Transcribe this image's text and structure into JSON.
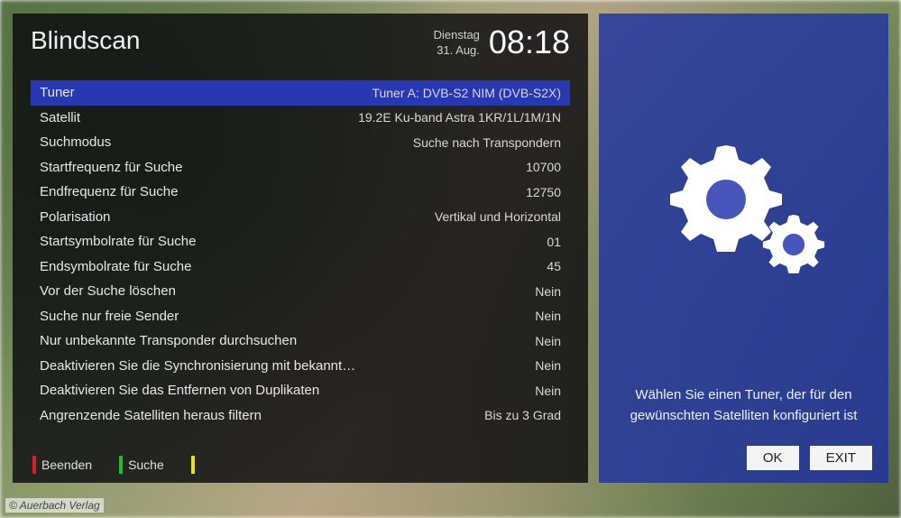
{
  "header": {
    "title": "Blindscan",
    "weekday": "Dienstag",
    "date": "31. Aug.",
    "time": "08:18"
  },
  "options": [
    {
      "label": "Tuner",
      "value": "Tuner A: DVB-S2 NIM (DVB-S2X)",
      "selected": true
    },
    {
      "label": "Satellit",
      "value": "19.2E Ku-band Astra 1KR/1L/1M/1N",
      "selected": false
    },
    {
      "label": "Suchmodus",
      "value": "Suche nach Transpondern",
      "selected": false
    },
    {
      "label": "Startfrequenz für Suche",
      "value": "10700",
      "selected": false
    },
    {
      "label": "Endfrequenz für Suche",
      "value": "12750",
      "selected": false
    },
    {
      "label": "Polarisation",
      "value": "Vertikal und Horizontal",
      "selected": false
    },
    {
      "label": "Startsymbolrate für Suche",
      "value": "01",
      "selected": false
    },
    {
      "label": "Endsymbolrate für Suche",
      "value": "45",
      "selected": false
    },
    {
      "label": "Vor der Suche löschen",
      "value": "Nein",
      "selected": false
    },
    {
      "label": "Suche nur freie Sender",
      "value": "Nein",
      "selected": false
    },
    {
      "label": "Nur unbekannte Transponder durchsuchen",
      "value": "Nein",
      "selected": false
    },
    {
      "label": "Deaktivieren Sie die Synchronisierung mit bekannten Transpondern",
      "value": "Nein",
      "selected": false
    },
    {
      "label": "Deaktivieren Sie das Entfernen von Duplikaten",
      "value": "Nein",
      "selected": false
    },
    {
      "label": "Angrenzende Satelliten heraus filtern",
      "value": "Bis zu 3 Grad",
      "selected": false
    }
  ],
  "color_buttons": {
    "red": "Beenden",
    "green": "Suche",
    "yellow": ""
  },
  "side": {
    "help_text": "Wählen Sie einen Tuner, der für den gewünschten Satelliten konfiguriert ist",
    "ok": "OK",
    "exit": "EXIT"
  },
  "copyright": "© Auerbach Verlag"
}
